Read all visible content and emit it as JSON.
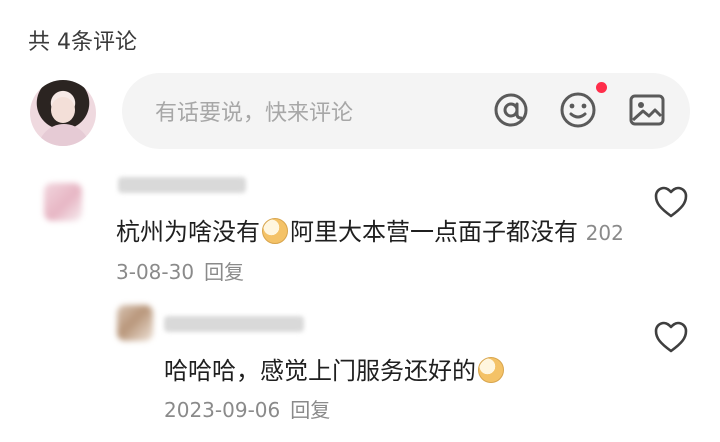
{
  "comments_header": {
    "count_label": "共 4条评论"
  },
  "composer": {
    "placeholder": "有话要说，快来评论",
    "icons": [
      "at-icon",
      "emoji-icon",
      "image-icon"
    ],
    "notification_dot_color": "#ff2d4a"
  },
  "comments": [
    {
      "text_part1": "杭州为啥没有",
      "text_part2": "阿里大本营一点面子都没有",
      "date": "2023-08-30",
      "reply_label": "回复",
      "inline_emoji": "crying-emoji"
    },
    {
      "text": "哈哈哈，感觉上门服务还好的",
      "date": "2023-09-06",
      "reply_label": "回复",
      "inline_emoji": "shy-emoji"
    }
  ],
  "colors": {
    "muted_text": "#8a8a8a",
    "body_text": "#1f1f1f",
    "input_bg": "#f4f4f4"
  }
}
